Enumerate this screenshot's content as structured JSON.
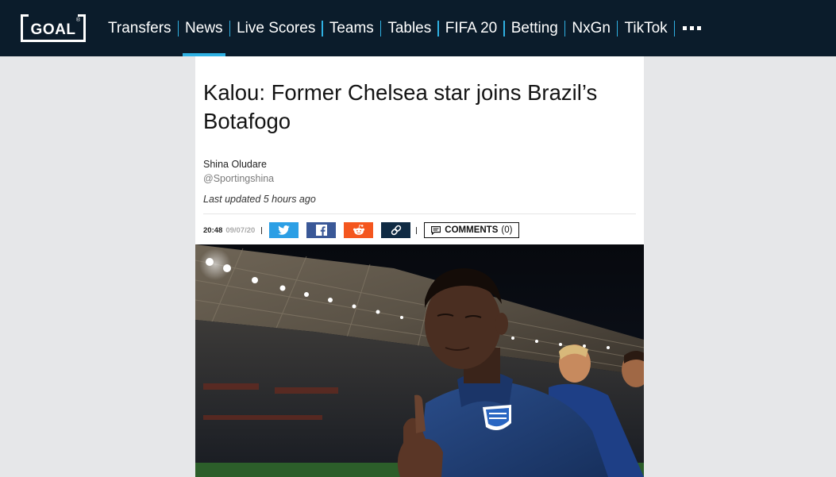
{
  "brand": {
    "logo_text": "GOAL"
  },
  "nav": {
    "items": [
      {
        "label": "Transfers",
        "active": false
      },
      {
        "label": "News",
        "active": true
      },
      {
        "label": "Live Scores",
        "active": false
      },
      {
        "label": "Teams",
        "active": false
      },
      {
        "label": "Tables",
        "active": false
      },
      {
        "label": "FIFA 20",
        "active": false
      },
      {
        "label": "Betting",
        "active": false
      },
      {
        "label": "NxGn",
        "active": false
      },
      {
        "label": "TikTok",
        "active": false
      }
    ],
    "more_icon": "ellipsis-icon"
  },
  "article": {
    "title": "Kalou: Former Chelsea star joins Brazil’s Botafogo",
    "author": "Shina Oludare",
    "handle": "@Sportingshina",
    "updated": "Last updated 5 hours ago",
    "time": "20:48",
    "date": "09/07/20",
    "share": [
      {
        "network": "twitter",
        "icon": "twitter-icon",
        "color": "#2c9fe5"
      },
      {
        "network": "facebook",
        "icon": "facebook-icon",
        "color": "#3a5897"
      },
      {
        "network": "reddit",
        "icon": "reddit-icon",
        "color": "#f4561e"
      },
      {
        "network": "copy-link",
        "icon": "link-icon",
        "color": "#0f2a43"
      }
    ],
    "comments_label": "COMMENTS",
    "comments_count": "(0)"
  },
  "colors": {
    "nav_bg": "#0b1c2b",
    "accent": "#2fb1e3",
    "page_bg": "#e6e7e9"
  }
}
